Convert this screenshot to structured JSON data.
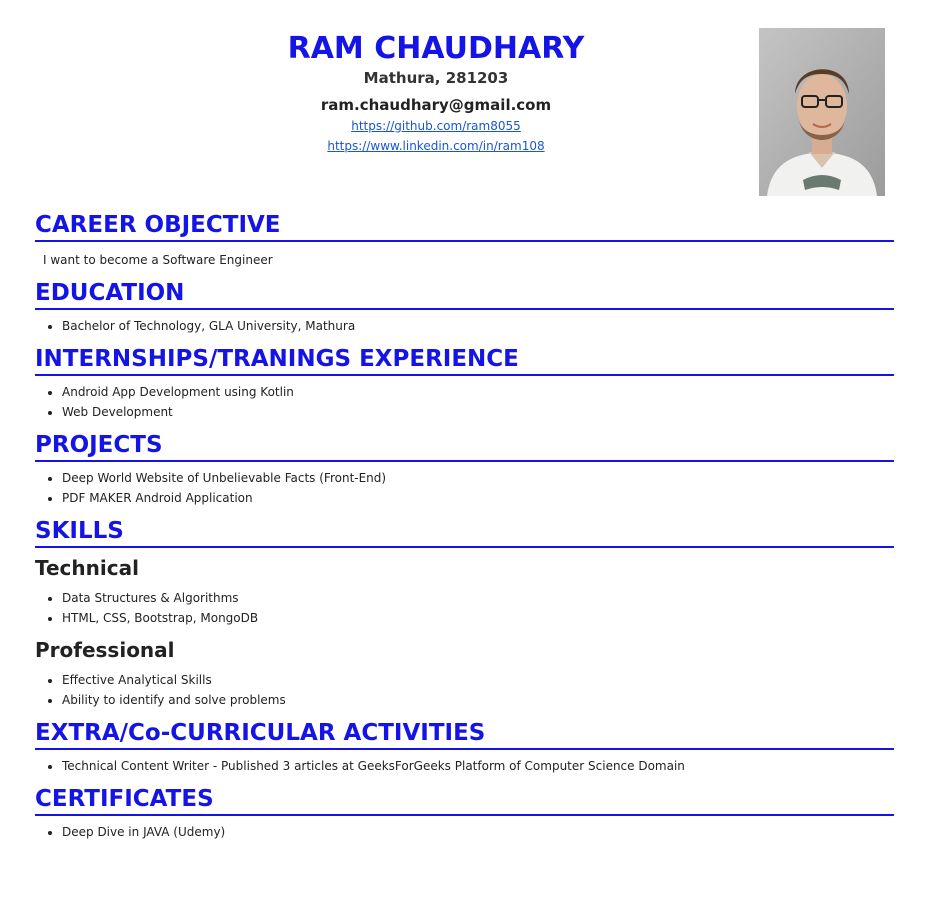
{
  "header": {
    "name": "RAM CHAUDHARY",
    "city": "Mathura, 281203",
    "email": "ram.chaudhary@gmail.com",
    "github": "https://github.com/ram8055",
    "linkedin": "https://www.linkedin.com/in/ram108"
  },
  "objective": {
    "title": "CAREER OBJECTIVE",
    "text": "I want to become a Software Engineer"
  },
  "education": {
    "title": "EDUCATION",
    "items": [
      "Bachelor of Technology, GLA University, Mathura"
    ]
  },
  "internships": {
    "title": "INTERNSHIPS/TRANINGS EXPERIENCE",
    "items": [
      "Android App Development using Kotlin",
      "Web Development"
    ]
  },
  "projects": {
    "title": "PROJECTS",
    "items": [
      "Deep World Website of Unbelievable Facts (Front-End)",
      "PDF MAKER Android Application"
    ]
  },
  "skills": {
    "title": "SKILLS",
    "technical_title": "Technical",
    "technical": [
      "Data Structures & Algorithms",
      "HTML, CSS, Bootstrap, MongoDB"
    ],
    "professional_title": "Professional",
    "professional": [
      "Effective Analytical Skills",
      "Ability to identify and solve problems"
    ]
  },
  "activities": {
    "title": "EXTRA/Co-CURRICULAR ACTIVITIES",
    "items": [
      "Technical Content Writer - Published 3 articles at GeeksForGeeks Platform of Computer Science Domain"
    ]
  },
  "certificates": {
    "title": "CERTIFICATES",
    "items": [
      "Deep Dive in JAVA (Udemy)"
    ]
  },
  "colors": {
    "accent": "#1414e6",
    "link": "#1a55d8"
  }
}
